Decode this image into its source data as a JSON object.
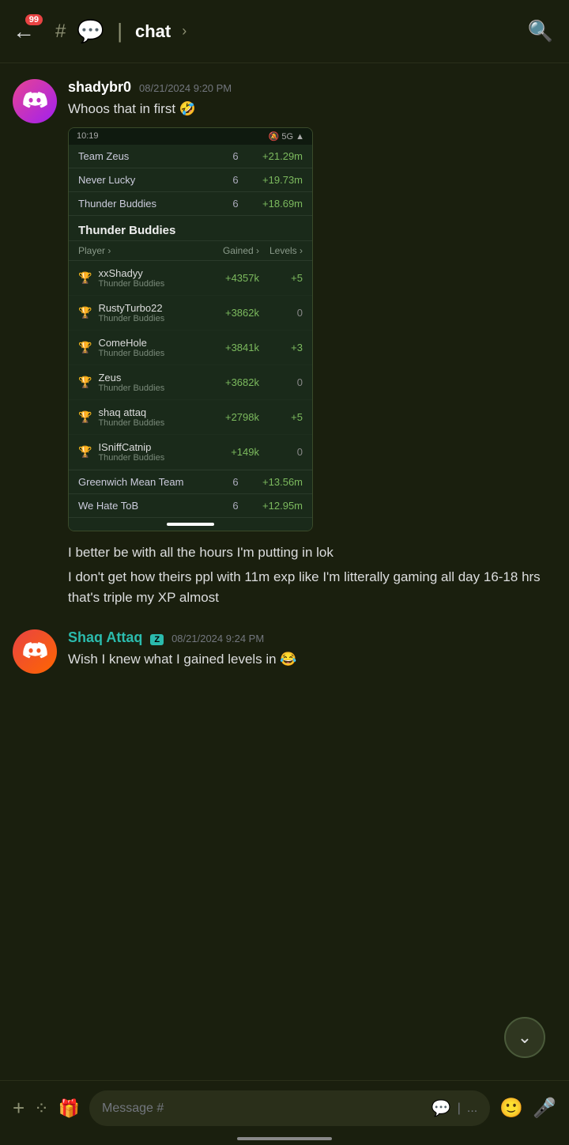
{
  "header": {
    "back_label": "←",
    "notification_count": "99",
    "channel_icon": "💬",
    "channel_name": "chat",
    "channel_chevron": "›",
    "search_icon": "🔍"
  },
  "messages": [
    {
      "id": "msg1",
      "username": "shadybr0",
      "username_color": "white",
      "timestamp": "08/21/2024 9:20 PM",
      "text": "Whoos that in first 🤣",
      "has_screenshot": true
    },
    {
      "id": "msg2",
      "text_part1": "I better be with all the hours I'm putting in lok",
      "text_part2": "I don't get how theirs ppl with 11m exp like I'm litterally gaming all day 16-18 hrs that's triple my XP almost"
    },
    {
      "id": "msg3",
      "username": "Shaq Attaq",
      "username_color": "teal",
      "badge": "Z",
      "timestamp": "08/21/2024 9:24 PM",
      "text": "Wish I knew what I gained levels in 😂"
    }
  ],
  "screenshot": {
    "status_bar_time": "10:19",
    "signal": "5G",
    "teams": [
      {
        "name": "Team Zeus",
        "count": "6",
        "xp": "+21.29m"
      },
      {
        "name": "Never Lucky",
        "count": "6",
        "xp": "+19.73m"
      },
      {
        "name": "Thunder Buddies",
        "count": "6",
        "xp": "+18.69m"
      }
    ],
    "section_title": "Thunder Buddies",
    "col_player": "Player",
    "col_gained": "Gained",
    "col_levels": "Levels",
    "players": [
      {
        "name": "xxShadyy",
        "team": "Thunder Buddies",
        "gained": "+4357k",
        "levels": "+5"
      },
      {
        "name": "RustyTurbo22",
        "team": "Thunder Buddies",
        "gained": "+3862k",
        "levels": "0"
      },
      {
        "name": "ComeHole",
        "team": "Thunder Buddies",
        "gained": "+3841k",
        "levels": "+3"
      },
      {
        "name": "Zeus",
        "team": "Thunder Buddies",
        "gained": "+3682k",
        "levels": "0"
      },
      {
        "name": "shaq attaq",
        "team": "Thunder Buddies",
        "gained": "+2798k",
        "levels": "+5"
      },
      {
        "name": "ISniffCatnip",
        "team": "Thunder Buddies",
        "gained": "+149k",
        "levels": "0"
      }
    ],
    "bottom_teams": [
      {
        "name": "Greenwich Mean Team",
        "count": "6",
        "xp": "+13.56m"
      },
      {
        "name": "We Hate ToB",
        "count": "6",
        "xp": "+12.95m"
      }
    ]
  },
  "toolbar": {
    "plus_label": "+",
    "apps_label": "⁞⁞",
    "gift_label": "🎁",
    "input_placeholder": "Message #",
    "emoji_label": "🙂",
    "mic_label": "🎤"
  }
}
